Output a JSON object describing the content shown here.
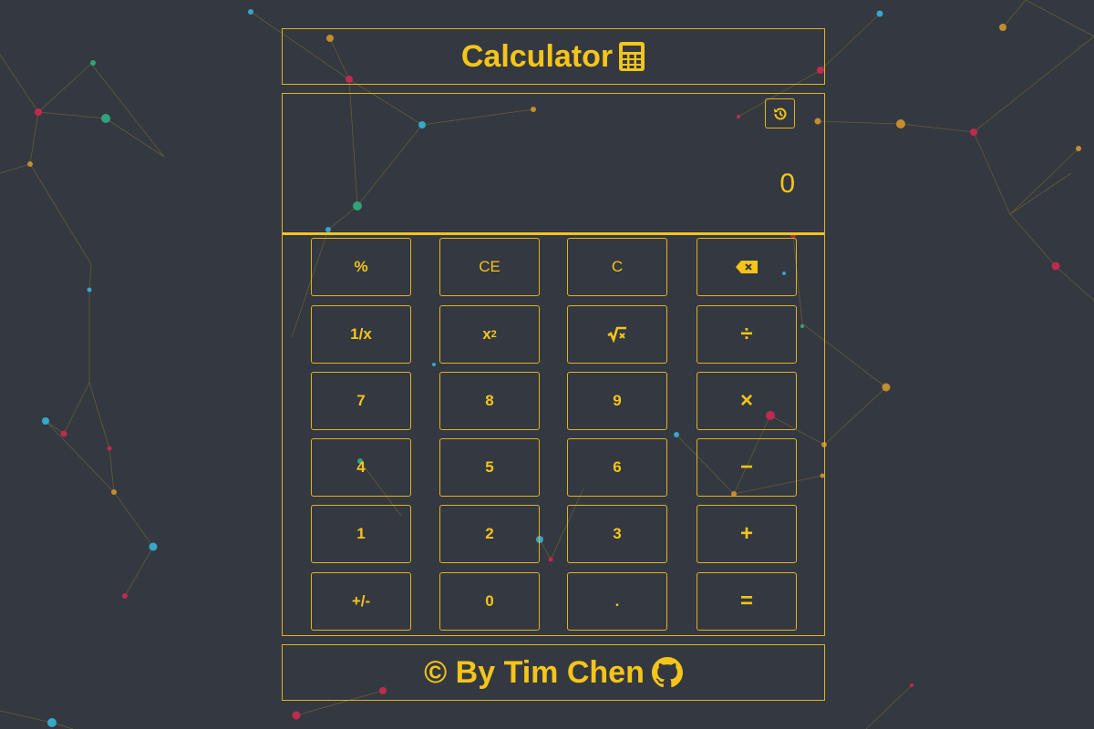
{
  "header": {
    "title": "Calculator",
    "icon": "calculator-icon"
  },
  "display": {
    "value": "0",
    "history_icon": "history-icon"
  },
  "keys": {
    "percent": "%",
    "clear_entry": "CE",
    "clear": "C",
    "backspace_icon": "backspace-icon",
    "reciprocal": "1/x",
    "square_base": "x",
    "square_exp": "2",
    "sqrt_icon": "square-root-icon",
    "divide": "÷",
    "seven": "7",
    "eight": "8",
    "nine": "9",
    "multiply": "×",
    "four": "4",
    "five": "5",
    "six": "6",
    "minus": "−",
    "one": "1",
    "two": "2",
    "three": "3",
    "plus": "+",
    "negate": "+/-",
    "zero": "0",
    "decimal": ".",
    "equals": "="
  },
  "footer": {
    "text": "© By Tim Chen",
    "icon": "github-icon"
  },
  "colors": {
    "background": "#343841",
    "accent": "#f5c518",
    "border": "#e0b31d"
  }
}
